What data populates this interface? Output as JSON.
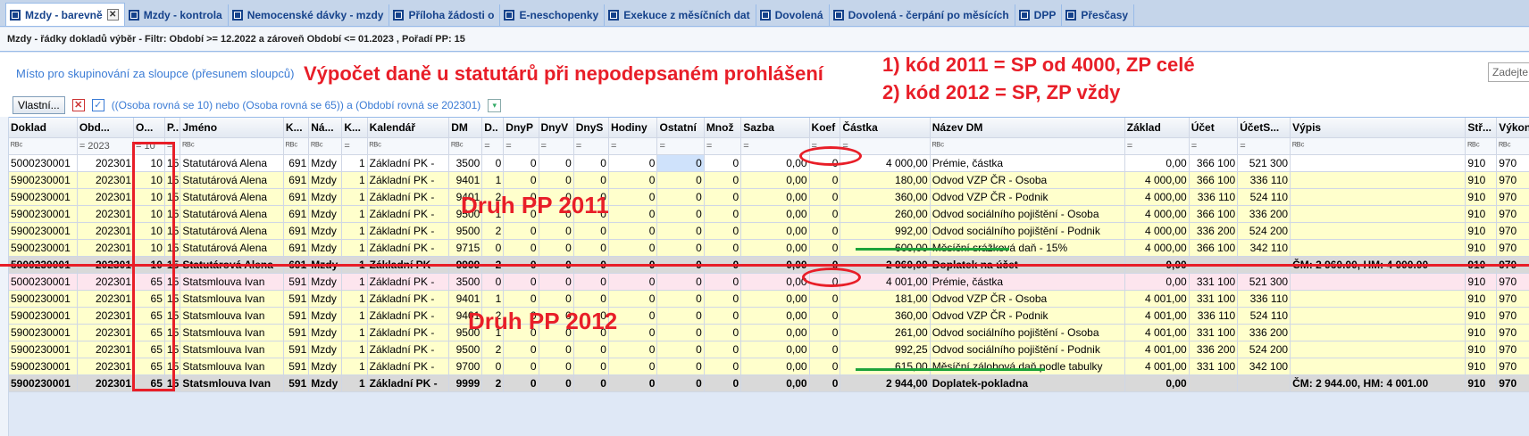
{
  "tabs": [
    {
      "label": "Mzdy - barevně",
      "active": true,
      "closable": true
    },
    {
      "label": "Mzdy - kontrola"
    },
    {
      "label": "Nemocenské dávky - mzdy"
    },
    {
      "label": "Příloha žádosti o"
    },
    {
      "label": "E-neschopenky"
    },
    {
      "label": "Exekuce z měsíčních dat"
    },
    {
      "label": "Dovolená"
    },
    {
      "label": "Dovolená - čerpání po měsících"
    },
    {
      "label": "DPP"
    },
    {
      "label": "Přesčasy"
    }
  ],
  "title_bar": "Mzdy - řádky dokladů výběr -  Filtr: Období >= 12.2022  a zároveň  Období <= 01.2023 , Pořadí PP: 15",
  "group_hint": "Místo pro skupinování za sloupce (přesunem sloupců)",
  "annotation_title": "Výpočet daně u statutárů při nepodepsaném prohlášení",
  "annotation_rule1": "1) kód 2011 = SP od 4000, ZP celé",
  "annotation_rule2": "2) kód 2012 = SP, ZP vždy",
  "search_placeholder": "Zadejte",
  "filter_button": "Vlastní...",
  "filter_expression": "((Osoba rovná se 10) nebo (Osoba rovná se 65)) a  (Období rovná se 202301)",
  "druh1_label": "Druh PP 2011",
  "druh2_label": "Druh PP 2012",
  "columns": [
    "Doklad",
    "Obd...",
    "O...",
    "P..",
    "Jméno",
    "K...",
    "Ná...",
    "K...",
    "Kalendář",
    "DM",
    "D..",
    "DnyP",
    "DnyV",
    "DnyS",
    "Hodiny",
    "Ostatní",
    "Množ",
    "Sazba",
    "Koef",
    "Částka",
    "Název DM",
    "Základ",
    "Účet",
    "ÚčetS...",
    "Výpis",
    "Stř...",
    "Výkon"
  ],
  "filter_values": [
    "ᴿᴮᶜ",
    "= 2023",
    "= 10",
    "=",
    "ᴿᴮᶜ",
    "ᴿᴮᶜ",
    "ᴿᴮᶜ",
    "=",
    "ᴿᴮᶜ",
    "ᴿᴮᶜ",
    "=",
    "=",
    "=",
    "=",
    "=",
    "=",
    "=",
    "=",
    "=",
    "=",
    "ᴿᴮᶜ",
    "=",
    "=",
    "=",
    "ᴿᴮᶜ",
    "ᴿᴮᶜ",
    "ᴿᴮᶜ"
  ],
  "rows": [
    {
      "style": "white",
      "cells": [
        "5000230001",
        "202301",
        "10",
        "15",
        "Statutárová Alena",
        "691",
        "Mzdy",
        "1",
        "Základní PK -",
        "3500",
        "0",
        "0",
        "0",
        "0",
        "0",
        "0",
        "0",
        "0,00",
        "0",
        "4 000,00",
        "Prémie, částka",
        "0,00",
        "366 100",
        "521 300",
        "",
        "910",
        "970"
      ]
    },
    {
      "style": "yellow",
      "cells": [
        "5900230001",
        "202301",
        "10",
        "15",
        "Statutárová Alena",
        "691",
        "Mzdy",
        "1",
        "Základní PK -",
        "9401",
        "1",
        "0",
        "0",
        "0",
        "0",
        "0",
        "0",
        "0,00",
        "0",
        "180,00",
        "Odvod VZP ČR - Osoba",
        "4 000,00",
        "366 100",
        "336 110",
        "",
        "910",
        "970"
      ]
    },
    {
      "style": "yellow",
      "cells": [
        "5900230001",
        "202301",
        "10",
        "15",
        "Statutárová Alena",
        "691",
        "Mzdy",
        "1",
        "Základní PK -",
        "9401",
        "2",
        "0",
        "0",
        "0",
        "0",
        "0",
        "0",
        "0,00",
        "0",
        "360,00",
        "Odvod VZP ČR - Podnik",
        "4 000,00",
        "336 110",
        "524 110",
        "",
        "910",
        "970"
      ]
    },
    {
      "style": "yellow",
      "cells": [
        "5900230001",
        "202301",
        "10",
        "15",
        "Statutárová Alena",
        "691",
        "Mzdy",
        "1",
        "Základní PK -",
        "9500",
        "1",
        "0",
        "0",
        "0",
        "0",
        "0",
        "0",
        "0,00",
        "0",
        "260,00",
        "Odvod sociálního pojištění - Osoba",
        "4 000,00",
        "366 100",
        "336 200",
        "",
        "910",
        "970"
      ]
    },
    {
      "style": "yellow",
      "cells": [
        "5900230001",
        "202301",
        "10",
        "15",
        "Statutárová Alena",
        "691",
        "Mzdy",
        "1",
        "Základní PK -",
        "9500",
        "2",
        "0",
        "0",
        "0",
        "0",
        "0",
        "0",
        "0,00",
        "0",
        "992,00",
        "Odvod sociálního pojištění - Podnik",
        "4 000,00",
        "336 200",
        "524 200",
        "",
        "910",
        "970"
      ]
    },
    {
      "style": "yellow",
      "cells": [
        "5900230001",
        "202301",
        "10",
        "15",
        "Statutárová Alena",
        "691",
        "Mzdy",
        "1",
        "Základní PK -",
        "9715",
        "0",
        "0",
        "0",
        "0",
        "0",
        "0",
        "0",
        "0,00",
        "0",
        "600,00",
        "Měsíční srážková daň - 15%",
        "4 000,00",
        "366 100",
        "342 110",
        "",
        "910",
        "970"
      ]
    },
    {
      "style": "sum",
      "cells": [
        "5900230001",
        "202301",
        "10",
        "15",
        "Statutárová Alena",
        "691",
        "Mzdy",
        "1",
        "Základní PK -",
        "9999",
        "2",
        "0",
        "0",
        "0",
        "0",
        "0",
        "0",
        "0,00",
        "0",
        "2 960,00",
        "Doplatek na účet",
        "0,00",
        "",
        "",
        "ČM: 2 960.00, HM: 4 000.00",
        "910",
        "970"
      ]
    },
    {
      "style": "pink",
      "cells": [
        "5000230001",
        "202301",
        "65",
        "15",
        "Statsmlouva Ivan",
        "591",
        "Mzdy",
        "1",
        "Základní PK -",
        "3500",
        "0",
        "0",
        "0",
        "0",
        "0",
        "0",
        "0",
        "0,00",
        "0",
        "4 001,00",
        "Prémie, částka",
        "0,00",
        "331 100",
        "521 300",
        "",
        "910",
        "970"
      ]
    },
    {
      "style": "yellow",
      "cells": [
        "5900230001",
        "202301",
        "65",
        "15",
        "Statsmlouva Ivan",
        "591",
        "Mzdy",
        "1",
        "Základní PK -",
        "9401",
        "1",
        "0",
        "0",
        "0",
        "0",
        "0",
        "0",
        "0,00",
        "0",
        "181,00",
        "Odvod VZP ČR - Osoba",
        "4 001,00",
        "331 100",
        "336 110",
        "",
        "910",
        "970"
      ]
    },
    {
      "style": "yellow",
      "cells": [
        "5900230001",
        "202301",
        "65",
        "15",
        "Statsmlouva Ivan",
        "591",
        "Mzdy",
        "1",
        "Základní PK -",
        "9401",
        "2",
        "0",
        "0",
        "0",
        "0",
        "0",
        "0",
        "0,00",
        "0",
        "360,00",
        "Odvod VZP ČR - Podnik",
        "4 001,00",
        "336 110",
        "524 110",
        "",
        "910",
        "970"
      ]
    },
    {
      "style": "yellow",
      "cells": [
        "5900230001",
        "202301",
        "65",
        "15",
        "Statsmlouva Ivan",
        "591",
        "Mzdy",
        "1",
        "Základní PK -",
        "9500",
        "1",
        "0",
        "0",
        "0",
        "0",
        "0",
        "0",
        "0,00",
        "0",
        "261,00",
        "Odvod sociálního pojištění - Osoba",
        "4 001,00",
        "331 100",
        "336 200",
        "",
        "910",
        "970"
      ]
    },
    {
      "style": "yellow",
      "cells": [
        "5900230001",
        "202301",
        "65",
        "15",
        "Statsmlouva Ivan",
        "591",
        "Mzdy",
        "1",
        "Základní PK -",
        "9500",
        "2",
        "0",
        "0",
        "0",
        "0",
        "0",
        "0",
        "0,00",
        "0",
        "992,25",
        "Odvod sociálního pojištění - Podnik",
        "4 001,00",
        "336 200",
        "524 200",
        "",
        "910",
        "970"
      ]
    },
    {
      "style": "yellow",
      "cells": [
        "5900230001",
        "202301",
        "65",
        "15",
        "Statsmlouva Ivan",
        "591",
        "Mzdy",
        "1",
        "Základní PK -",
        "9700",
        "0",
        "0",
        "0",
        "0",
        "0",
        "0",
        "0",
        "0,00",
        "0",
        "615,00",
        "Měsíční zálohová daň podle tabulky",
        "4 001,00",
        "331 100",
        "342 100",
        "",
        "910",
        "970"
      ]
    },
    {
      "style": "sum",
      "cells": [
        "5900230001",
        "202301",
        "65",
        "15",
        "Statsmlouva Ivan",
        "591",
        "Mzdy",
        "1",
        "Základní PK -",
        "9999",
        "2",
        "0",
        "0",
        "0",
        "0",
        "0",
        "0",
        "0,00",
        "0",
        "2 944,00",
        "Doplatek-pokladna",
        "0,00",
        "",
        "",
        "ČM: 2 944.00, HM: 4 001.00",
        "910",
        "970"
      ]
    }
  ]
}
